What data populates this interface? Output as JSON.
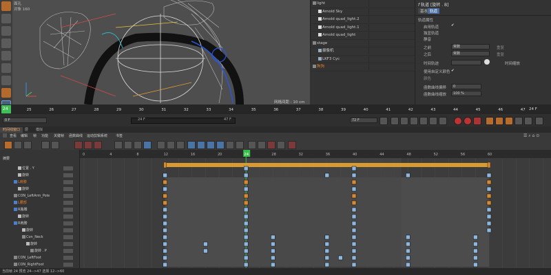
{
  "viewport": {
    "info_label_1": "面孔",
    "info_label_2": "对象",
    "info_value_2": "160",
    "grid_label": "网格间距 : 10 cm"
  },
  "object_manager": {
    "rows": [
      {
        "label": "light",
        "indent": 0,
        "icon": "layer",
        "color": "#ccc"
      },
      {
        "label": "Arnold Sky",
        "indent": 1,
        "icon": "light",
        "color": "#ccc"
      },
      {
        "label": "Arnold quad_light.2",
        "indent": 1,
        "icon": "light",
        "color": "#ccc"
      },
      {
        "label": "Arnold quad_light.1",
        "indent": 1,
        "icon": "light",
        "color": "#ccc"
      },
      {
        "label": "Arnold quad_light",
        "indent": 1,
        "icon": "light",
        "color": "#ccc"
      },
      {
        "label": "stage",
        "indent": 0,
        "icon": "layer",
        "color": "#ccc"
      },
      {
        "label": "摄像机",
        "indent": 1,
        "icon": "camera",
        "color": "#ccc"
      },
      {
        "label": "LKF3 Cyc",
        "indent": 1,
        "icon": "object",
        "color": "#ccc"
      },
      {
        "label": "狗狗",
        "indent": 0,
        "icon": "layer",
        "color": "#e07f2a"
      }
    ]
  },
  "attributes": {
    "header": "轨道 [旋转 . B]",
    "tab_basic": "基本",
    "tab_track": "轨道",
    "section_title": "轨道属性",
    "enable_label": "启用轨道",
    "solo_label": "独显轨道",
    "sound_label": "静音",
    "before_label": "之前",
    "before_value": "常数",
    "after_label": "之后",
    "after_value": "常数",
    "repeat_label": "重复",
    "repeat_value": "0",
    "track_label": "时间轨迹",
    "scale_label": "时间缩放",
    "use_color_label": "使用自定义颜色",
    "color_label": "颜色",
    "fcurve_offset_label": "函数曲线偏移",
    "fcurve_offset_value": "0",
    "fcurve_scale_label": "函数曲线缩放",
    "fcurve_scale_value": "100 %"
  },
  "ruler": {
    "frames": [
      "24",
      "25",
      "26",
      "27",
      "28",
      "29",
      "30",
      "31",
      "32",
      "33",
      "34",
      "35",
      "36",
      "37",
      "38",
      "39",
      "40",
      "41",
      "42",
      "43",
      "44",
      "45",
      "46",
      "47"
    ],
    "current_frame": "24",
    "end_label": "24 F"
  },
  "playback": {
    "start_field": "0 F",
    "range_start": "24 F",
    "range_end": "47 F",
    "end_field": "72 F"
  },
  "tabs": [
    {
      "label": "时间线窗口",
      "active": true
    },
    {
      "label": "层",
      "active": false
    },
    {
      "label": "模拟",
      "active": false
    }
  ],
  "menu": [
    "查看",
    "编辑",
    "帧",
    "功能",
    "关键帧",
    "函数曲线",
    "运动剪辑系统",
    "书签"
  ],
  "timeline": {
    "tree_header": "摘要",
    "scale_labels": [
      "0",
      "4",
      "8",
      "12",
      "16",
      "20",
      "24",
      "28",
      "32",
      "36",
      "40",
      "44",
      "48",
      "52",
      "56",
      "60"
    ],
    "current_frame": "24",
    "summary_bar_color": "#d89a33",
    "tree_rows": [
      {
        "label": "位置 . Y",
        "indent": 2,
        "icon": "folder"
      },
      {
        "label": "旋转",
        "indent": 2,
        "icon": "folder"
      },
      {
        "label": "L肩膀",
        "indent": 1,
        "icon": "joint",
        "color": "#e07f2a"
      },
      {
        "label": "旋转",
        "indent": 2,
        "icon": "folder"
      },
      {
        "label": "CON_LeftArm_Pole",
        "indent": 1,
        "icon": "null"
      },
      {
        "label": "L腰部",
        "indent": 1,
        "icon": "joint",
        "color": "#e07f2a"
      },
      {
        "label": "R胳膊",
        "indent": 1,
        "icon": "joint"
      },
      {
        "label": "旋转",
        "indent": 2,
        "icon": "folder"
      },
      {
        "label": "R肩膀",
        "indent": 1,
        "icon": "joint"
      },
      {
        "label": "旋转",
        "indent": 3,
        "icon": "folder"
      },
      {
        "label": "Con_Neck",
        "indent": 3,
        "icon": "null"
      },
      {
        "label": "旋转",
        "indent": 4,
        "icon": "folder"
      },
      {
        "label": "旋转 . P",
        "indent": 5,
        "icon": "track"
      },
      {
        "label": "CON_LeftFoot",
        "indent": 1,
        "icon": "null"
      },
      {
        "label": "CON_RightFoot",
        "indent": 1,
        "icon": "null"
      },
      {
        "label": "L脚掌",
        "indent": 2,
        "icon": "joint"
      },
      {
        "label": "旋转",
        "indent": 3,
        "icon": "folder"
      }
    ]
  },
  "status": {
    "text": "当前帧 24 预览 24-->47 选择 12-->60"
  },
  "colors": {
    "key_orange": "#d88a30",
    "key_blue": "#8fb6dc",
    "accent_orange": "#e07f2a",
    "current_frame_green": "#37c04a"
  }
}
